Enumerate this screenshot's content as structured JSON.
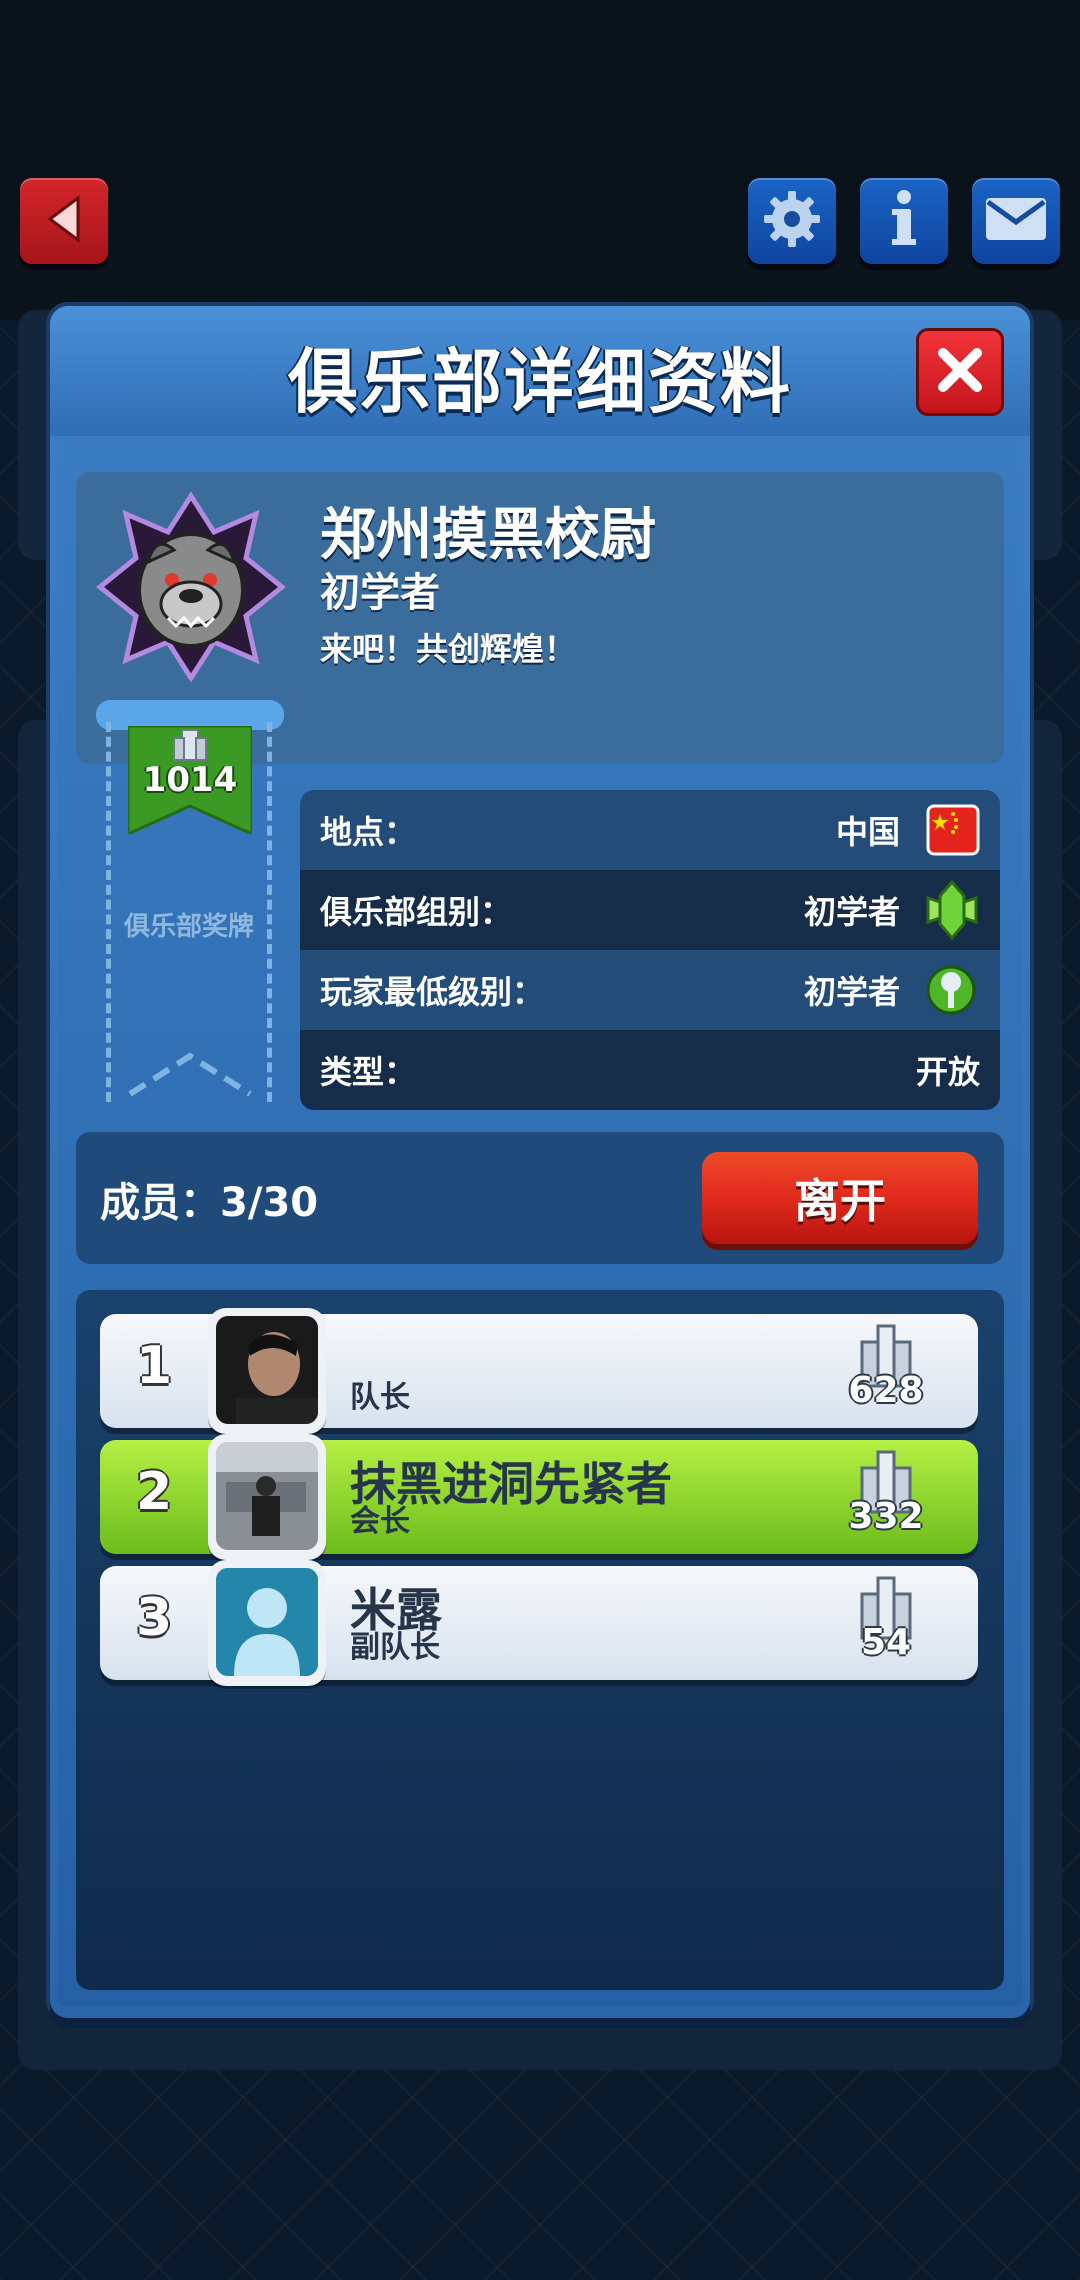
{
  "screen": {
    "title": "俱乐部详细资料",
    "accent_red": "#e0251d",
    "panel_blue": "#3a7cc2"
  },
  "top_bar": {
    "back_icon": "back-arrow-icon",
    "settings_icon": "gear-icon",
    "info_icon": "info-icon",
    "mail_icon": "mail-icon"
  },
  "club": {
    "name": "郑州摸黑校尉",
    "level": "初学者",
    "motto": "来吧！共创辉煌！",
    "emblem_icon": "bulldog-emblem-icon",
    "trophies": "1014",
    "medal_label": "俱乐部奖牌"
  },
  "info": {
    "location_label": "地点：",
    "location_value": "中国",
    "group_label": "俱乐部组别：",
    "group_value": "初学者",
    "min_level_label": "玩家最低级别：",
    "min_level_value": "初学者",
    "type_label": "类型：",
    "type_value": "开放"
  },
  "members": {
    "label": "成员：",
    "count": "3/30",
    "leave_button": "离开"
  },
  "member_list": [
    {
      "rank": "1",
      "name": "",
      "role": "队长",
      "trophies": "628",
      "highlight": false
    },
    {
      "rank": "2",
      "name": "抹黑进洞先紧者",
      "role": "会长",
      "trophies": "332",
      "highlight": true
    },
    {
      "rank": "3",
      "name": "米露",
      "role": "副队长",
      "trophies": "54",
      "highlight": false
    }
  ]
}
